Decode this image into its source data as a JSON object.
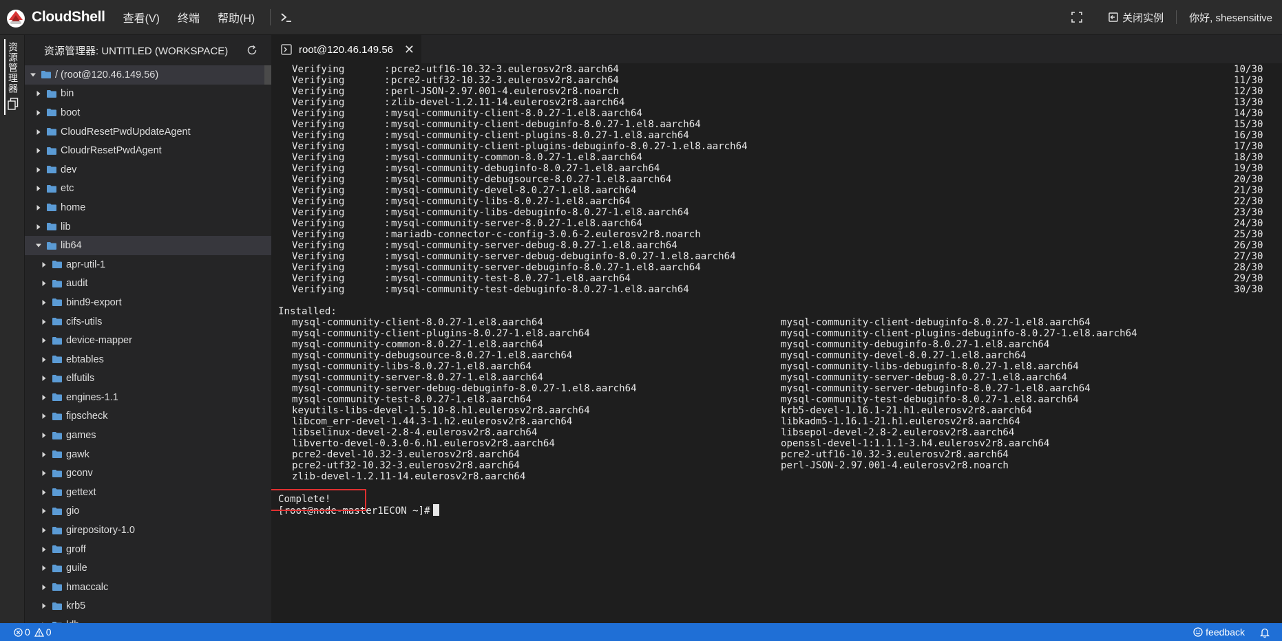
{
  "app": {
    "title": "CloudShell",
    "menu": [
      "查看(V)",
      "终端",
      "帮助(H)"
    ],
    "terminal_button": ">_",
    "close_instance_label": "关闭实例",
    "greeting": "你好, shesensitive"
  },
  "activity": {
    "explorer_label": "资源管理器"
  },
  "sidebar": {
    "header": "资源管理器: UNTITLED (WORKSPACE)",
    "tree": [
      {
        "label": "/ (root@120.46.149.56)",
        "depth": 0,
        "expanded": true,
        "selected": true
      },
      {
        "label": "bin",
        "depth": 1,
        "expanded": false
      },
      {
        "label": "boot",
        "depth": 1,
        "expanded": false
      },
      {
        "label": "CloudResetPwdUpdateAgent",
        "depth": 1,
        "expanded": false
      },
      {
        "label": "CloudrResetPwdAgent",
        "depth": 1,
        "expanded": false
      },
      {
        "label": "dev",
        "depth": 1,
        "expanded": false
      },
      {
        "label": "etc",
        "depth": 1,
        "expanded": false
      },
      {
        "label": "home",
        "depth": 1,
        "expanded": false
      },
      {
        "label": "lib",
        "depth": 1,
        "expanded": false
      },
      {
        "label": "lib64",
        "depth": 1,
        "expanded": true,
        "selected": true
      },
      {
        "label": "apr-util-1",
        "depth": 2,
        "expanded": false
      },
      {
        "label": "audit",
        "depth": 2,
        "expanded": false
      },
      {
        "label": "bind9-export",
        "depth": 2,
        "expanded": false
      },
      {
        "label": "cifs-utils",
        "depth": 2,
        "expanded": false
      },
      {
        "label": "device-mapper",
        "depth": 2,
        "expanded": false
      },
      {
        "label": "ebtables",
        "depth": 2,
        "expanded": false
      },
      {
        "label": "elfutils",
        "depth": 2,
        "expanded": false
      },
      {
        "label": "engines-1.1",
        "depth": 2,
        "expanded": false
      },
      {
        "label": "fipscheck",
        "depth": 2,
        "expanded": false
      },
      {
        "label": "games",
        "depth": 2,
        "expanded": false
      },
      {
        "label": "gawk",
        "depth": 2,
        "expanded": false
      },
      {
        "label": "gconv",
        "depth": 2,
        "expanded": false
      },
      {
        "label": "gettext",
        "depth": 2,
        "expanded": false
      },
      {
        "label": "gio",
        "depth": 2,
        "expanded": false
      },
      {
        "label": "girepository-1.0",
        "depth": 2,
        "expanded": false
      },
      {
        "label": "groff",
        "depth": 2,
        "expanded": false
      },
      {
        "label": "guile",
        "depth": 2,
        "expanded": false
      },
      {
        "label": "hmaccalc",
        "depth": 2,
        "expanded": false
      },
      {
        "label": "krb5",
        "depth": 2,
        "expanded": false
      },
      {
        "label": "ldb",
        "depth": 2,
        "expanded": false
      }
    ]
  },
  "tab": {
    "label": "root@120.46.149.56",
    "close": "✕"
  },
  "terminal": {
    "verifying": [
      {
        "verb": "Verifying",
        "sep": ":",
        "pkg": "pcre2-utf16-10.32-3.eulerosv2r8.aarch64",
        "count": "10/30"
      },
      {
        "verb": "Verifying",
        "sep": ":",
        "pkg": "pcre2-utf32-10.32-3.eulerosv2r8.aarch64",
        "count": "11/30"
      },
      {
        "verb": "Verifying",
        "sep": ":",
        "pkg": "perl-JSON-2.97.001-4.eulerosv2r8.noarch",
        "count": "12/30"
      },
      {
        "verb": "Verifying",
        "sep": ":",
        "pkg": "zlib-devel-1.2.11-14.eulerosv2r8.aarch64",
        "count": "13/30"
      },
      {
        "verb": "Verifying",
        "sep": ":",
        "pkg": "mysql-community-client-8.0.27-1.el8.aarch64",
        "count": "14/30"
      },
      {
        "verb": "Verifying",
        "sep": ":",
        "pkg": "mysql-community-client-debuginfo-8.0.27-1.el8.aarch64",
        "count": "15/30"
      },
      {
        "verb": "Verifying",
        "sep": ":",
        "pkg": "mysql-community-client-plugins-8.0.27-1.el8.aarch64",
        "count": "16/30"
      },
      {
        "verb": "Verifying",
        "sep": ":",
        "pkg": "mysql-community-client-plugins-debuginfo-8.0.27-1.el8.aarch64",
        "count": "17/30"
      },
      {
        "verb": "Verifying",
        "sep": ":",
        "pkg": "mysql-community-common-8.0.27-1.el8.aarch64",
        "count": "18/30"
      },
      {
        "verb": "Verifying",
        "sep": ":",
        "pkg": "mysql-community-debuginfo-8.0.27-1.el8.aarch64",
        "count": "19/30"
      },
      {
        "verb": "Verifying",
        "sep": ":",
        "pkg": "mysql-community-debugsource-8.0.27-1.el8.aarch64",
        "count": "20/30"
      },
      {
        "verb": "Verifying",
        "sep": ":",
        "pkg": "mysql-community-devel-8.0.27-1.el8.aarch64",
        "count": "21/30"
      },
      {
        "verb": "Verifying",
        "sep": ":",
        "pkg": "mysql-community-libs-8.0.27-1.el8.aarch64",
        "count": "22/30"
      },
      {
        "verb": "Verifying",
        "sep": ":",
        "pkg": "mysql-community-libs-debuginfo-8.0.27-1.el8.aarch64",
        "count": "23/30"
      },
      {
        "verb": "Verifying",
        "sep": ":",
        "pkg": "mysql-community-server-8.0.27-1.el8.aarch64",
        "count": "24/30"
      },
      {
        "verb": "Verifying",
        "sep": ":",
        "pkg": "mariadb-connector-c-config-3.0.6-2.eulerosv2r8.noarch",
        "count": "25/30"
      },
      {
        "verb": "Verifying",
        "sep": ":",
        "pkg": "mysql-community-server-debug-8.0.27-1.el8.aarch64",
        "count": "26/30"
      },
      {
        "verb": "Verifying",
        "sep": ":",
        "pkg": "mysql-community-server-debug-debuginfo-8.0.27-1.el8.aarch64",
        "count": "27/30"
      },
      {
        "verb": "Verifying",
        "sep": ":",
        "pkg": "mysql-community-server-debuginfo-8.0.27-1.el8.aarch64",
        "count": "28/30"
      },
      {
        "verb": "Verifying",
        "sep": ":",
        "pkg": "mysql-community-test-8.0.27-1.el8.aarch64",
        "count": "29/30"
      },
      {
        "verb": "Verifying",
        "sep": ":",
        "pkg": "mysql-community-test-debuginfo-8.0.27-1.el8.aarch64",
        "count": "30/30"
      }
    ],
    "installed_header": "Installed:",
    "installed": [
      [
        "mysql-community-client-8.0.27-1.el8.aarch64",
        "mysql-community-client-debuginfo-8.0.27-1.el8.aarch64"
      ],
      [
        "mysql-community-client-plugins-8.0.27-1.el8.aarch64",
        "mysql-community-client-plugins-debuginfo-8.0.27-1.el8.aarch64"
      ],
      [
        "mysql-community-common-8.0.27-1.el8.aarch64",
        "mysql-community-debuginfo-8.0.27-1.el8.aarch64"
      ],
      [
        "mysql-community-debugsource-8.0.27-1.el8.aarch64",
        "mysql-community-devel-8.0.27-1.el8.aarch64"
      ],
      [
        "mysql-community-libs-8.0.27-1.el8.aarch64",
        "mysql-community-libs-debuginfo-8.0.27-1.el8.aarch64"
      ],
      [
        "mysql-community-server-8.0.27-1.el8.aarch64",
        "mysql-community-server-debug-8.0.27-1.el8.aarch64"
      ],
      [
        "mysql-community-server-debug-debuginfo-8.0.27-1.el8.aarch64",
        "mysql-community-server-debuginfo-8.0.27-1.el8.aarch64"
      ],
      [
        "mysql-community-test-8.0.27-1.el8.aarch64",
        "mysql-community-test-debuginfo-8.0.27-1.el8.aarch64"
      ],
      [
        "keyutils-libs-devel-1.5.10-8.h1.eulerosv2r8.aarch64",
        "krb5-devel-1.16.1-21.h1.eulerosv2r8.aarch64"
      ],
      [
        "libcom_err-devel-1.44.3-1.h2.eulerosv2r8.aarch64",
        "libkadm5-1.16.1-21.h1.eulerosv2r8.aarch64"
      ],
      [
        "libselinux-devel-2.8-4.eulerosv2r8.aarch64",
        "libsepol-devel-2.8-2.eulerosv2r8.aarch64"
      ],
      [
        "libverto-devel-0.3.0-6.h1.eulerosv2r8.aarch64",
        "openssl-devel-1:1.1.1-3.h4.eulerosv2r8.aarch64"
      ],
      [
        "pcre2-devel-10.32-3.eulerosv2r8.aarch64",
        "pcre2-utf16-10.32-3.eulerosv2r8.aarch64"
      ],
      [
        "pcre2-utf32-10.32-3.eulerosv2r8.aarch64",
        "perl-JSON-2.97.001-4.eulerosv2r8.noarch"
      ],
      [
        "zlib-devel-1.2.11-14.eulerosv2r8.aarch64",
        ""
      ]
    ],
    "complete": "Complete!",
    "prompt": "[root@node-master1ECON ~]#"
  },
  "status": {
    "errors": "0",
    "warnings": "0",
    "feedback": "feedback"
  },
  "colors": {
    "accent": "#1f6fd6",
    "folder": "#5b9bd5",
    "highlight_box": "#e03030"
  }
}
